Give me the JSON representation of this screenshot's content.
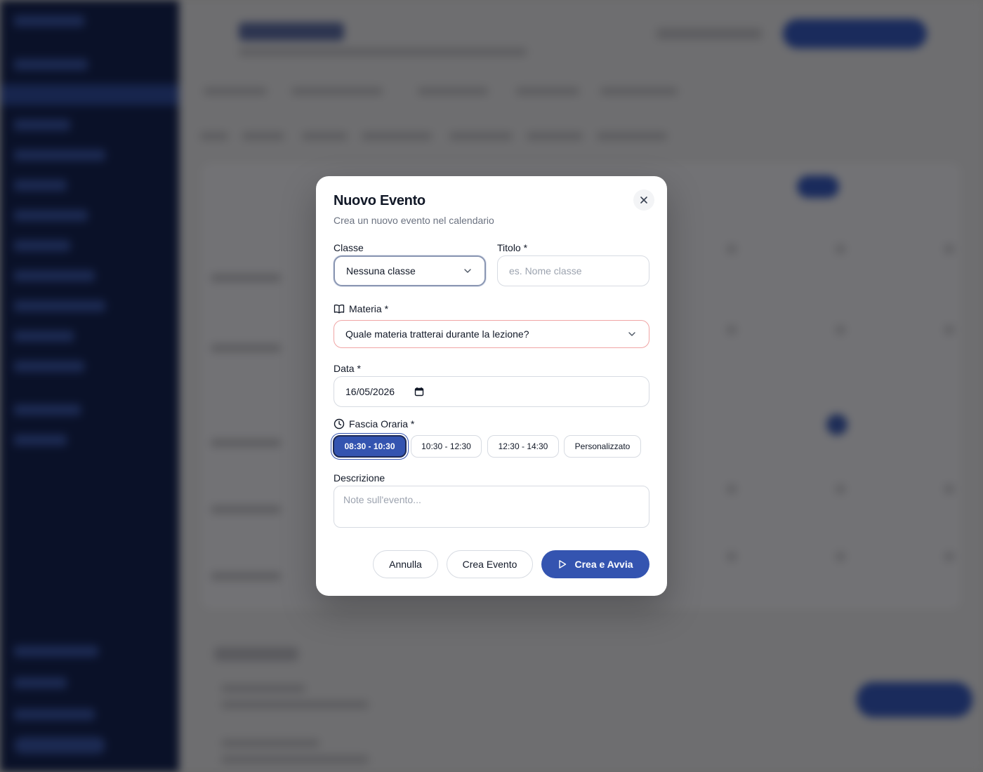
{
  "modal": {
    "title": "Nuovo Evento",
    "subtitle": "Crea un nuovo evento nel calendario",
    "close_icon": "close-icon",
    "classe": {
      "label": "Classe",
      "value": "Nessuna classe"
    },
    "titolo": {
      "label": "Titolo *",
      "placeholder": "es. Nome classe"
    },
    "materia": {
      "label": "Materia *",
      "value": "Quale materia tratterai durante la lezione?",
      "icon": "book-icon"
    },
    "data": {
      "label": "Data *",
      "value": "16/05/2026",
      "icon": "calendar-icon"
    },
    "fascia": {
      "label": "Fascia Oraria *",
      "icon": "clock-icon",
      "slots": [
        "08:30 - 10:30",
        "10:30 - 12:30",
        "12:30 - 14:30",
        "Personalizzato"
      ],
      "selected": "08:30 - 10:30"
    },
    "descrizione": {
      "label": "Descrizione",
      "placeholder": "Note sull'evento..."
    },
    "buttons": {
      "cancel": "Annulla",
      "create": "Crea Evento",
      "create_start": "Crea e Avvia"
    },
    "colors": {
      "primary": "#3454b0",
      "error_border": "#f0a5a5",
      "border": "#d7dbe2"
    }
  }
}
